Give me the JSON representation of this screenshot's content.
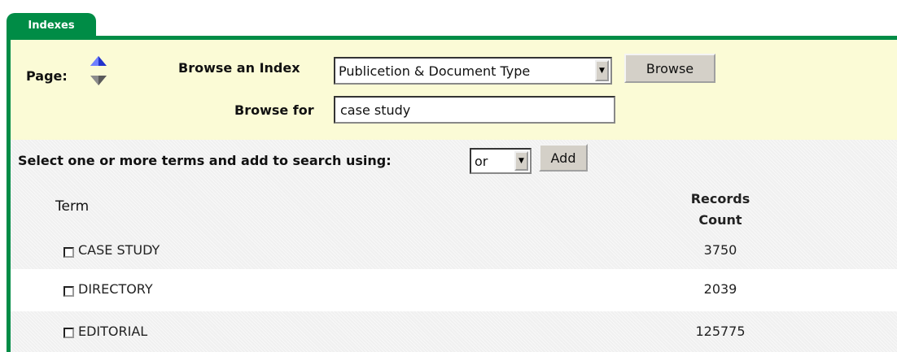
{
  "tab": {
    "label": "Indexes"
  },
  "page_label": "Page:",
  "browse_index": {
    "label": "Browse an Index",
    "selected": "Publicetion & Document Type",
    "button": "Browse"
  },
  "browse_for": {
    "label": "Browse for",
    "value": "case study"
  },
  "select_terms": {
    "label": "Select one or more terms and add to search using:",
    "operator": "or",
    "add_button": "Add"
  },
  "table": {
    "col_term": "Term",
    "col_records_line1": "Records",
    "col_records_line2": "Count",
    "rows": [
      {
        "term": "CASE STUDY",
        "count": "3750"
      },
      {
        "term": "DIRECTORY",
        "count": "2039"
      },
      {
        "term": "EDITORIAL",
        "count": "125775"
      }
    ]
  },
  "colors": {
    "tab_green": "#008c46",
    "panel_yellow": "#fbfbd6",
    "arrow_blue": "#2233cc"
  }
}
